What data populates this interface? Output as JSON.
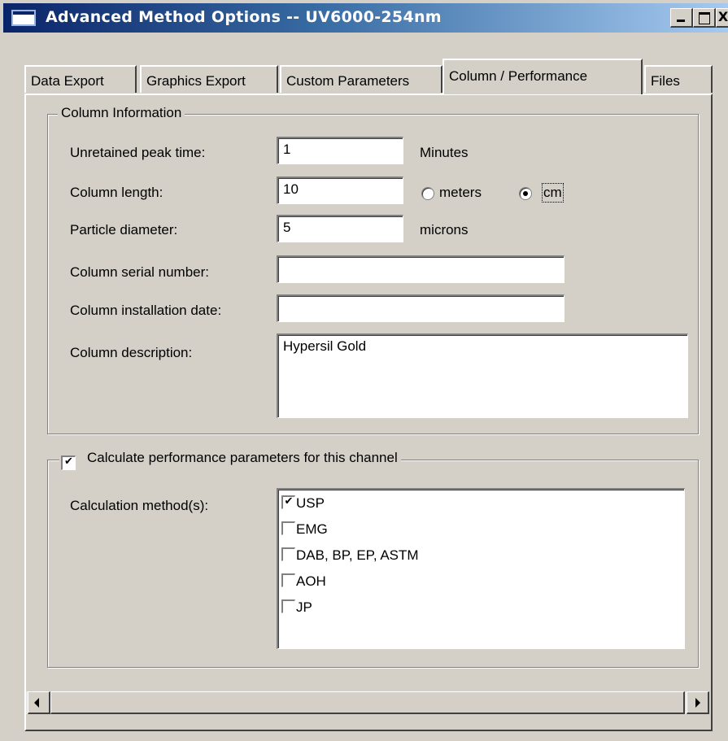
{
  "window": {
    "title": "Advanced Method Options -- UV6000-254nm",
    "close_label": "X"
  },
  "tabs": [
    {
      "label": "Data Export"
    },
    {
      "label": "Graphics Export"
    },
    {
      "label": "Custom Parameters"
    },
    {
      "label": "Column / Performance",
      "active": true
    },
    {
      "label": "Files"
    }
  ],
  "column_info": {
    "legend": "Column Information",
    "unretained_label": "Unretained peak time:",
    "unretained_value": "1",
    "unretained_unit": "Minutes",
    "length_label": "Column length:",
    "length_value": "10",
    "unit_meters": "meters",
    "unit_cm": "cm",
    "selected_unit": "cm",
    "particle_label": "Particle diameter:",
    "particle_value": "5",
    "particle_unit": "microns",
    "serial_label": "Column serial number:",
    "serial_value": "",
    "install_label": "Column installation date:",
    "install_value": "",
    "description_label": "Column description:",
    "description_value": "Hypersil Gold"
  },
  "performance": {
    "legend": "Calculate performance parameters for this channel",
    "enabled": true,
    "method_label": "Calculation method(s):",
    "methods": [
      {
        "label": "USP",
        "checked": true
      },
      {
        "label": "EMG",
        "checked": false
      },
      {
        "label": "DAB, BP, EP, ASTM",
        "checked": false
      },
      {
        "label": "AOH",
        "checked": false
      },
      {
        "label": "JP",
        "checked": false
      }
    ]
  },
  "icons": {
    "check_mark": "✔"
  }
}
